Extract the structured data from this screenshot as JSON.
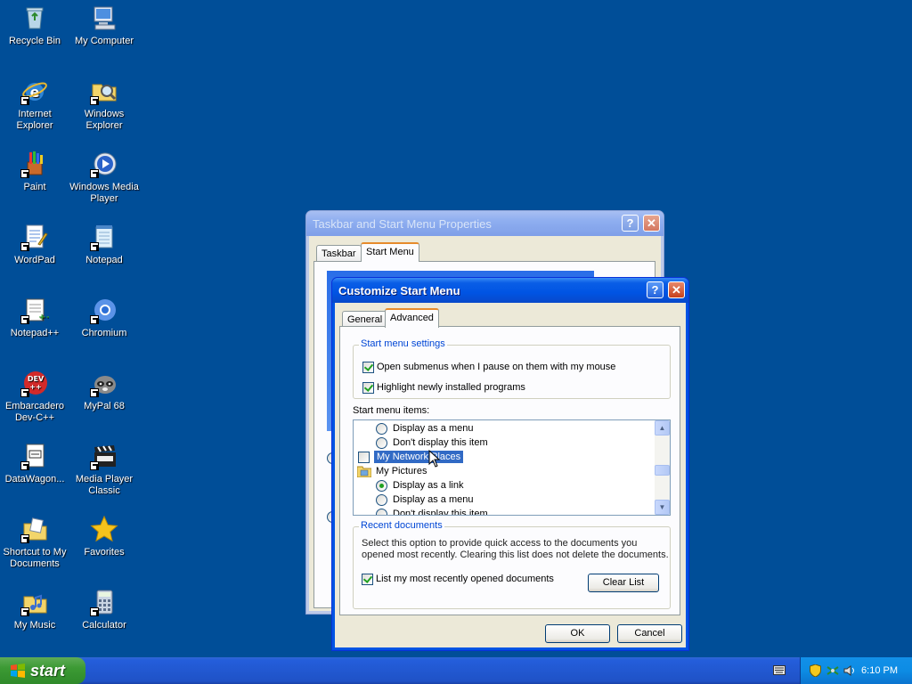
{
  "desktop": {
    "icons": [
      {
        "label": "Recycle Bin"
      },
      {
        "label": "My Computer"
      },
      {
        "label": "Internet Explorer"
      },
      {
        "label": "Windows Explorer"
      },
      {
        "label": "Paint"
      },
      {
        "label": "Windows Media Player"
      },
      {
        "label": "WordPad"
      },
      {
        "label": "Notepad"
      },
      {
        "label": "Notepad++"
      },
      {
        "label": "Chromium"
      },
      {
        "label": "Embarcadero Dev-C++"
      },
      {
        "label": "MyPal 68"
      },
      {
        "label": "DataWagon..."
      },
      {
        "label": "Media Player Classic"
      },
      {
        "label": "Shortcut to My Documents"
      },
      {
        "label": "Favorites"
      },
      {
        "label": "My Music"
      },
      {
        "label": "Calculator"
      }
    ]
  },
  "taskbar_props": {
    "title": "Taskbar and Start Menu Properties",
    "tabs": [
      "Taskbar",
      "Start Menu"
    ]
  },
  "customize": {
    "title": "Customize Start Menu",
    "tabs": [
      "General",
      "Advanced"
    ],
    "settings_group": "Start menu settings",
    "opt_submenus": "Open submenus when I pause on them with my mouse",
    "opt_highlight": "Highlight newly installed programs",
    "items_label": "Start menu items:",
    "items": [
      "Display as a menu",
      "Don't display this item",
      "My Network Places",
      "My Pictures",
      "Display as a link",
      "Display as a menu",
      "Don't display this item"
    ],
    "recent_group": "Recent documents",
    "recent_desc1": "Select this option to provide quick access to the documents you",
    "recent_desc2": "opened most recently.  Clearing this list does not delete the documents.",
    "recent_check": "List my most recently opened documents",
    "clear_list": "Clear List",
    "ok": "OK",
    "cancel": "Cancel"
  },
  "taskbar": {
    "start": "start",
    "clock": "6:10 PM"
  },
  "colors": {
    "desktop": "#004e98",
    "titlebar_active": "#0054e3",
    "selection": "#316ac5",
    "check_green": "#21a121"
  }
}
